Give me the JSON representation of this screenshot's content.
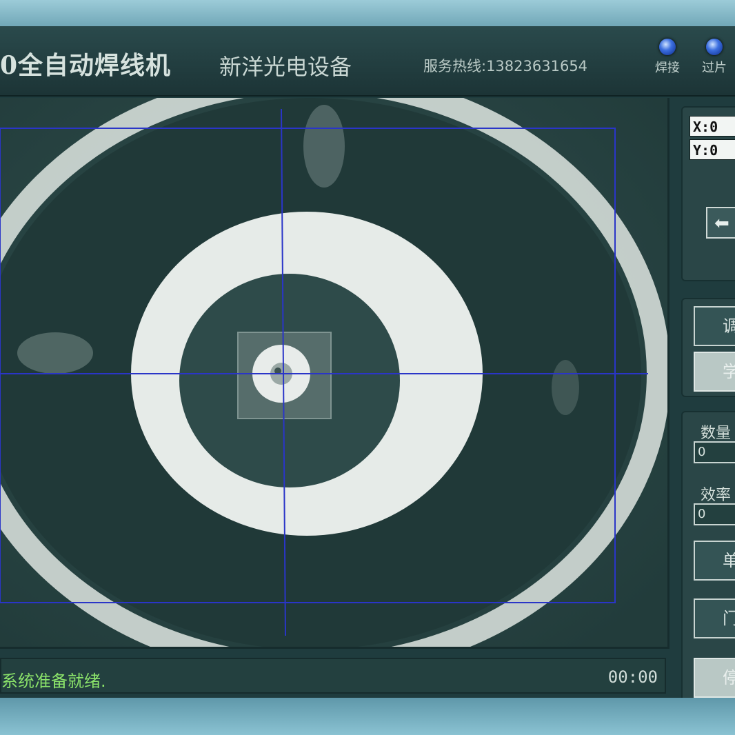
{
  "header": {
    "title": "0全自动焊线机",
    "company": "新洋光电设备",
    "hotline": "服务热线:13823631654",
    "indicators": [
      {
        "label": "焊接",
        "color": "#3c6fe0"
      },
      {
        "label": "过片",
        "color": "#3c6fe0"
      }
    ]
  },
  "coords": {
    "x": "X:0",
    "y": "Y:0"
  },
  "panel": {
    "arrow_icon": "arrow-left",
    "adjust_label": "调",
    "learn_label": "学",
    "qty_label": "数量",
    "qty_value": "0",
    "eff_label": "效率",
    "eff_value": "0",
    "single_label": "单",
    "door_label": "门",
    "stop_label": "停"
  },
  "status": {
    "message": "系统准备就绪.",
    "timer": "00:00"
  },
  "colors": {
    "background": "#1f3c3e",
    "crosshair": "#2a35c8",
    "status_text": "#8be36a"
  }
}
